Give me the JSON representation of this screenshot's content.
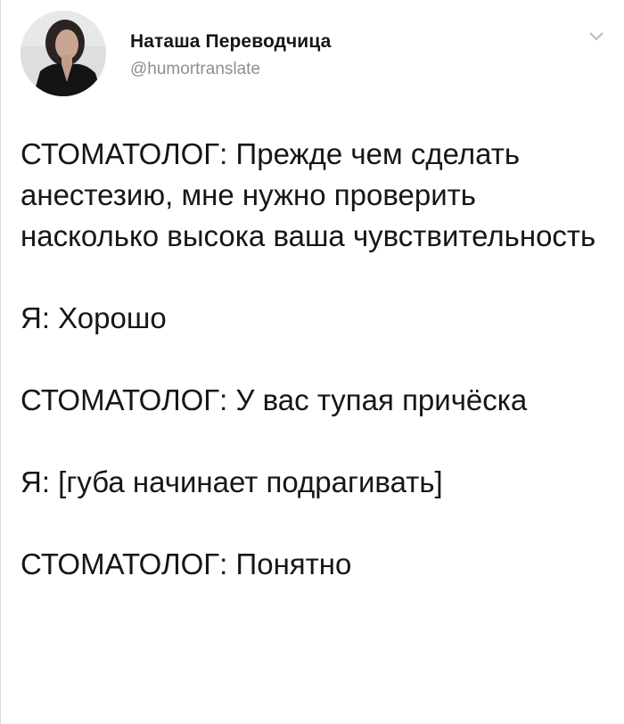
{
  "author": {
    "display_name": "Наташа Переводчица",
    "handle": "@humortranslate",
    "avatar_icon": "profile-photo"
  },
  "menu": {
    "icon": "chevron-down-icon"
  },
  "tweet": {
    "lines": [
      "СТОМАТОЛОГ: Прежде чем сделать анестезию, мне нужно проверить насколько высока ваша чувствительность",
      "Я: Хорошо",
      "СТОМАТОЛОГ: У вас тупая причёска",
      "Я: [губа начинает подрагивать]",
      "СТОМАТОЛОГ: Понятно"
    ]
  },
  "colors": {
    "text": "#14171a",
    "secondary": "#8a8f94",
    "background": "#ffffff"
  }
}
